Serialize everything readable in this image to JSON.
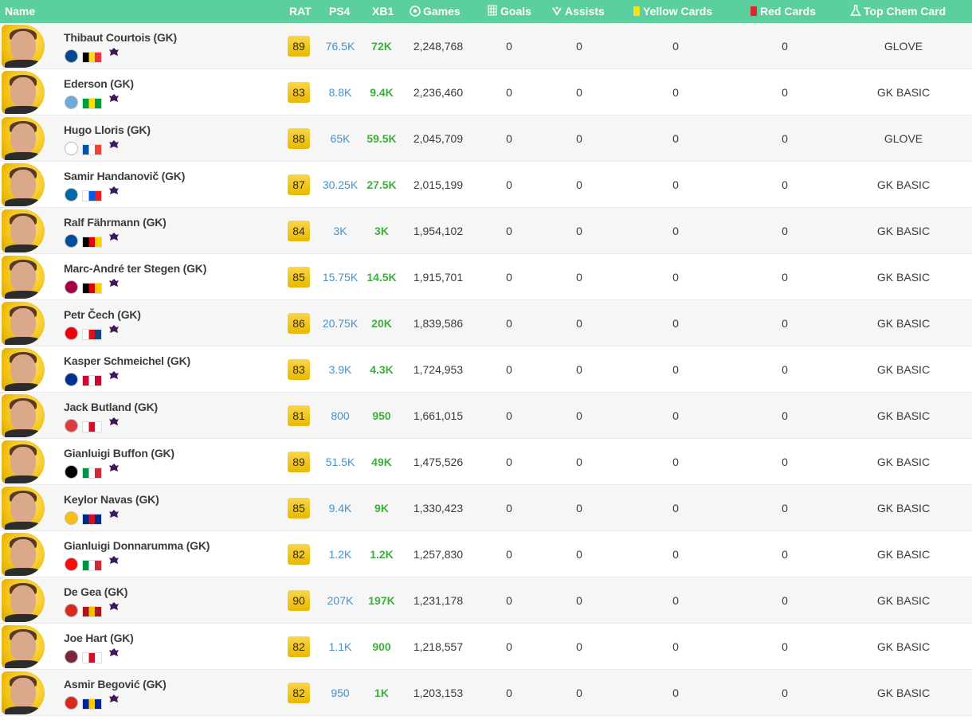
{
  "header": {
    "name": "Name",
    "rat": "RAT",
    "ps4": "PS4",
    "xb1": "XB1",
    "games": "Games",
    "goals": "Goals",
    "assists": "Assists",
    "yellow": "Yellow Cards",
    "red": "Red Cards",
    "chem": "Top Chem Card",
    "icons": {
      "games": "soccer-ball-icon",
      "goals": "goal-net-icon",
      "assists": "assist-icon",
      "yellow": "yellow-card-icon",
      "red": "red-card-icon",
      "chem": "chem-flask-icon"
    }
  },
  "colors": {
    "header_bg": "#5bcf9d",
    "rating_gold": "#e9b800",
    "ps4": "#4a90c9",
    "xb1": "#3fae3f"
  },
  "players": [
    {
      "name": "Thibaut Courtois (GK)",
      "rat": "89",
      "ps4": "76.5K",
      "xb1": "72K",
      "games": "2,248,768",
      "goals": "0",
      "assists": "0",
      "yellow": "0",
      "red": "0",
      "chem": "GLOVE",
      "club": "chelsea",
      "flag": "belgium",
      "league": "premier-league",
      "club_color": "#034694",
      "flag_colors": [
        "#000000",
        "#fdda24",
        "#ef3340"
      ]
    },
    {
      "name": "Ederson (GK)",
      "rat": "83",
      "ps4": "8.8K",
      "xb1": "9.4K",
      "games": "2,236,460",
      "goals": "0",
      "assists": "0",
      "yellow": "0",
      "red": "0",
      "chem": "GK BASIC",
      "club": "manchester-city",
      "flag": "brazil",
      "league": "premier-league",
      "club_color": "#6cabdd",
      "flag_colors": [
        "#009c3b",
        "#ffdf00",
        "#009c3b"
      ]
    },
    {
      "name": "Hugo Lloris (GK)",
      "rat": "88",
      "ps4": "65K",
      "xb1": "59.5K",
      "games": "2,045,709",
      "goals": "0",
      "assists": "0",
      "yellow": "0",
      "red": "0",
      "chem": "GLOVE",
      "club": "tottenham",
      "flag": "france",
      "league": "premier-league",
      "club_color": "#ffffff",
      "flag_colors": [
        "#0055a4",
        "#ffffff",
        "#ef4135"
      ]
    },
    {
      "name": "Samir Handanovič (GK)",
      "rat": "87",
      "ps4": "30.25K",
      "xb1": "27.5K",
      "games": "2,015,199",
      "goals": "0",
      "assists": "0",
      "yellow": "0",
      "red": "0",
      "chem": "GK BASIC",
      "club": "inter",
      "flag": "slovenia",
      "league": "calcio-a",
      "club_color": "#0068a8",
      "flag_colors": [
        "#ffffff",
        "#005ce5",
        "#ed1c24"
      ]
    },
    {
      "name": "Ralf Fährmann (GK)",
      "rat": "84",
      "ps4": "3K",
      "xb1": "3K",
      "games": "1,954,102",
      "goals": "0",
      "assists": "0",
      "yellow": "0",
      "red": "0",
      "chem": "GK BASIC",
      "club": "schalke",
      "flag": "germany",
      "league": "bundesliga",
      "club_color": "#004d9d",
      "flag_colors": [
        "#000000",
        "#dd0000",
        "#ffce00"
      ]
    },
    {
      "name": "Marc-André ter Stegen (GK)",
      "rat": "85",
      "ps4": "15.75K",
      "xb1": "14.5K",
      "games": "1,915,701",
      "goals": "0",
      "assists": "0",
      "yellow": "0",
      "red": "0",
      "chem": "GK BASIC",
      "club": "barcelona",
      "flag": "germany",
      "league": "laliga",
      "club_color": "#a50044",
      "flag_colors": [
        "#000000",
        "#dd0000",
        "#ffce00"
      ]
    },
    {
      "name": "Petr Čech (GK)",
      "rat": "86",
      "ps4": "20.75K",
      "xb1": "20K",
      "games": "1,839,586",
      "goals": "0",
      "assists": "0",
      "yellow": "0",
      "red": "0",
      "chem": "GK BASIC",
      "club": "arsenal",
      "flag": "czech-republic",
      "league": "premier-league",
      "club_color": "#ef0107",
      "flag_colors": [
        "#ffffff",
        "#d7141a",
        "#11457e"
      ]
    },
    {
      "name": "Kasper Schmeichel (GK)",
      "rat": "83",
      "ps4": "3.9K",
      "xb1": "4.3K",
      "games": "1,724,953",
      "goals": "0",
      "assists": "0",
      "yellow": "0",
      "red": "0",
      "chem": "GK BASIC",
      "club": "leicester",
      "flag": "denmark",
      "league": "premier-league",
      "club_color": "#003090",
      "flag_colors": [
        "#c60c30",
        "#ffffff",
        "#c60c30"
      ]
    },
    {
      "name": "Jack Butland (GK)",
      "rat": "81",
      "ps4": "800",
      "xb1": "950",
      "games": "1,661,015",
      "goals": "0",
      "assists": "0",
      "yellow": "0",
      "red": "0",
      "chem": "GK BASIC",
      "club": "stoke",
      "flag": "england",
      "league": "premier-league",
      "club_color": "#e03a3e",
      "flag_colors": [
        "#ffffff",
        "#ce1124",
        "#ffffff"
      ]
    },
    {
      "name": "Gianluigi Buffon (GK)",
      "rat": "89",
      "ps4": "51.5K",
      "xb1": "49K",
      "games": "1,475,526",
      "goals": "0",
      "assists": "0",
      "yellow": "0",
      "red": "0",
      "chem": "GK BASIC",
      "club": "juventus",
      "flag": "italy",
      "league": "calcio-a",
      "club_color": "#000000",
      "flag_colors": [
        "#009246",
        "#ffffff",
        "#ce2b37"
      ]
    },
    {
      "name": "Keylor Navas (GK)",
      "rat": "85",
      "ps4": "9.4K",
      "xb1": "9K",
      "games": "1,330,423",
      "goals": "0",
      "assists": "0",
      "yellow": "0",
      "red": "0",
      "chem": "GK BASIC",
      "club": "real-madrid",
      "flag": "costa-rica",
      "league": "laliga",
      "club_color": "#febe10",
      "flag_colors": [
        "#002b7f",
        "#ce1126",
        "#002b7f"
      ]
    },
    {
      "name": "Gianluigi Donnarumma (GK)",
      "rat": "82",
      "ps4": "1.2K",
      "xb1": "1.2K",
      "games": "1,257,830",
      "goals": "0",
      "assists": "0",
      "yellow": "0",
      "red": "0",
      "chem": "GK BASIC",
      "club": "ac-milan",
      "flag": "italy",
      "league": "calcio-a",
      "club_color": "#fb090b",
      "flag_colors": [
        "#009246",
        "#ffffff",
        "#ce2b37"
      ]
    },
    {
      "name": "De Gea (GK)",
      "rat": "90",
      "ps4": "207K",
      "xb1": "197K",
      "games": "1,231,178",
      "goals": "0",
      "assists": "0",
      "yellow": "0",
      "red": "0",
      "chem": "GK BASIC",
      "club": "manchester-united",
      "flag": "spain",
      "league": "premier-league",
      "club_color": "#da291c",
      "flag_colors": [
        "#aa151b",
        "#f1bf00",
        "#aa151b"
      ]
    },
    {
      "name": "Joe Hart (GK)",
      "rat": "82",
      "ps4": "1.1K",
      "xb1": "900",
      "games": "1,218,557",
      "goals": "0",
      "assists": "0",
      "yellow": "0",
      "red": "0",
      "chem": "GK BASIC",
      "club": "west-ham",
      "flag": "england",
      "league": "premier-league",
      "club_color": "#7a263a",
      "flag_colors": [
        "#ffffff",
        "#ce1124",
        "#ffffff"
      ]
    },
    {
      "name": "Asmir Begović (GK)",
      "rat": "82",
      "ps4": "950",
      "xb1": "1K",
      "games": "1,203,153",
      "goals": "0",
      "assists": "0",
      "yellow": "0",
      "red": "0",
      "chem": "GK BASIC",
      "club": "bournemouth",
      "flag": "bosnia",
      "league": "premier-league",
      "club_color": "#da291c",
      "flag_colors": [
        "#002395",
        "#fecb00",
        "#002395"
      ]
    }
  ]
}
